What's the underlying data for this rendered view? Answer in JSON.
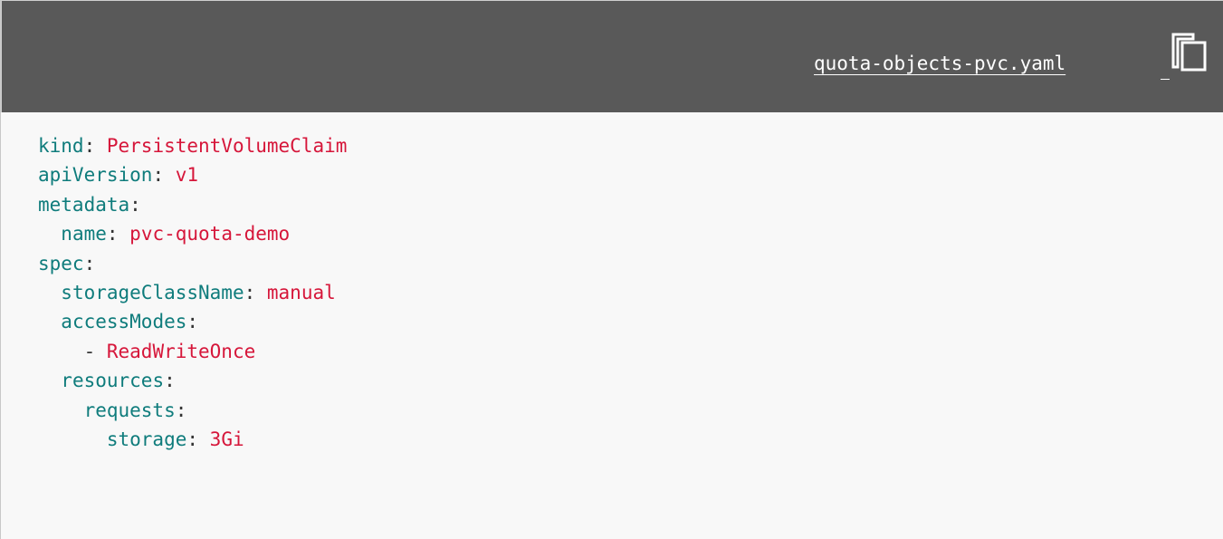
{
  "header": {
    "filename": "quota-objects-pvc.yaml",
    "copy_icon": "copy-icon"
  },
  "code": {
    "lines": [
      {
        "indent": "",
        "dash": "",
        "key": "kind",
        "sep": ": ",
        "value": "PersistentVolumeClaim"
      },
      {
        "indent": "",
        "dash": "",
        "key": "apiVersion",
        "sep": ": ",
        "value": "v1"
      },
      {
        "indent": "",
        "dash": "",
        "key": "metadata",
        "sep": ":",
        "value": ""
      },
      {
        "indent": "  ",
        "dash": "",
        "key": "name",
        "sep": ": ",
        "value": "pvc-quota-demo"
      },
      {
        "indent": "",
        "dash": "",
        "key": "spec",
        "sep": ":",
        "value": ""
      },
      {
        "indent": "  ",
        "dash": "",
        "key": "storageClassName",
        "sep": ": ",
        "value": "manual"
      },
      {
        "indent": "  ",
        "dash": "",
        "key": "accessModes",
        "sep": ":",
        "value": ""
      },
      {
        "indent": "    ",
        "dash": "- ",
        "key": "",
        "sep": "",
        "value": "ReadWriteOnce"
      },
      {
        "indent": "  ",
        "dash": "",
        "key": "resources",
        "sep": ":",
        "value": ""
      },
      {
        "indent": "    ",
        "dash": "",
        "key": "requests",
        "sep": ":",
        "value": ""
      },
      {
        "indent": "      ",
        "dash": "",
        "key": "storage",
        "sep": ": ",
        "value": "3Gi"
      }
    ]
  },
  "colors": {
    "header_bg": "#595959",
    "key": "#0f7c7c",
    "value": "#d6163a"
  }
}
